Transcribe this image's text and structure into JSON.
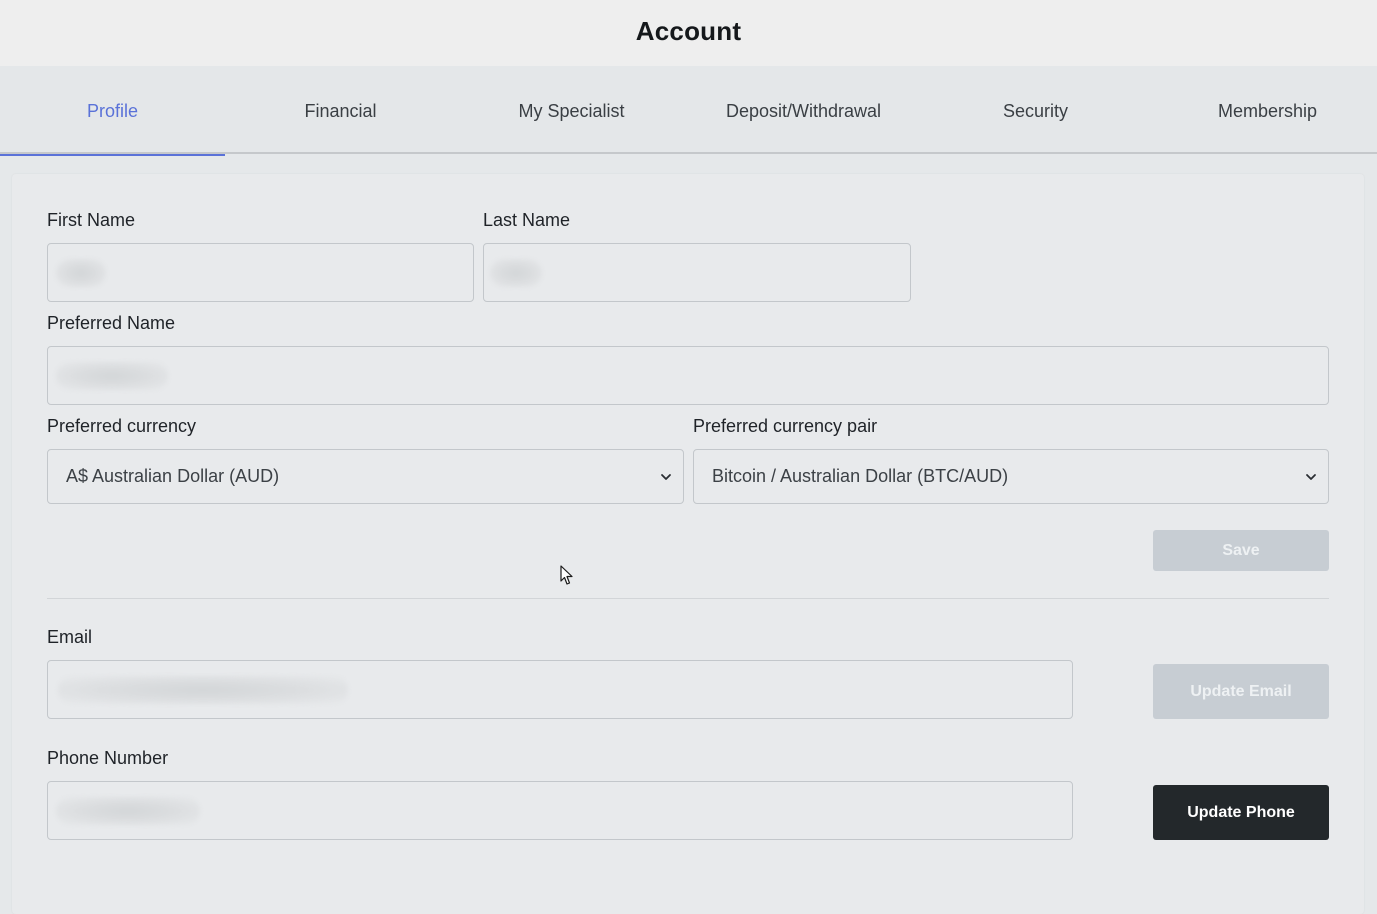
{
  "header": {
    "title": "Account"
  },
  "tabs": [
    {
      "label": "Profile",
      "active": true
    },
    {
      "label": "Financial",
      "active": false
    },
    {
      "label": "My Specialist",
      "active": false
    },
    {
      "label": "Deposit/Withdrawal",
      "active": false
    },
    {
      "label": "Security",
      "active": false
    },
    {
      "label": "Membership",
      "active": false
    }
  ],
  "form": {
    "first_name_label": "First Name",
    "last_name_label": "Last Name",
    "preferred_name_label": "Preferred Name",
    "preferred_currency_label": "Preferred currency",
    "preferred_currency_value": "A$ Australian Dollar (AUD)",
    "preferred_pair_label": "Preferred currency pair",
    "preferred_pair_value": "Bitcoin / Australian Dollar (BTC/AUD)",
    "save_label": "Save",
    "email_label": "Email",
    "update_email_label": "Update Email",
    "phone_label": "Phone Number",
    "update_phone_label": "Update Phone"
  },
  "colors": {
    "accent": "#5a72d8",
    "dark_button": "#23282b",
    "disabled_button": "#c7cdd3"
  }
}
